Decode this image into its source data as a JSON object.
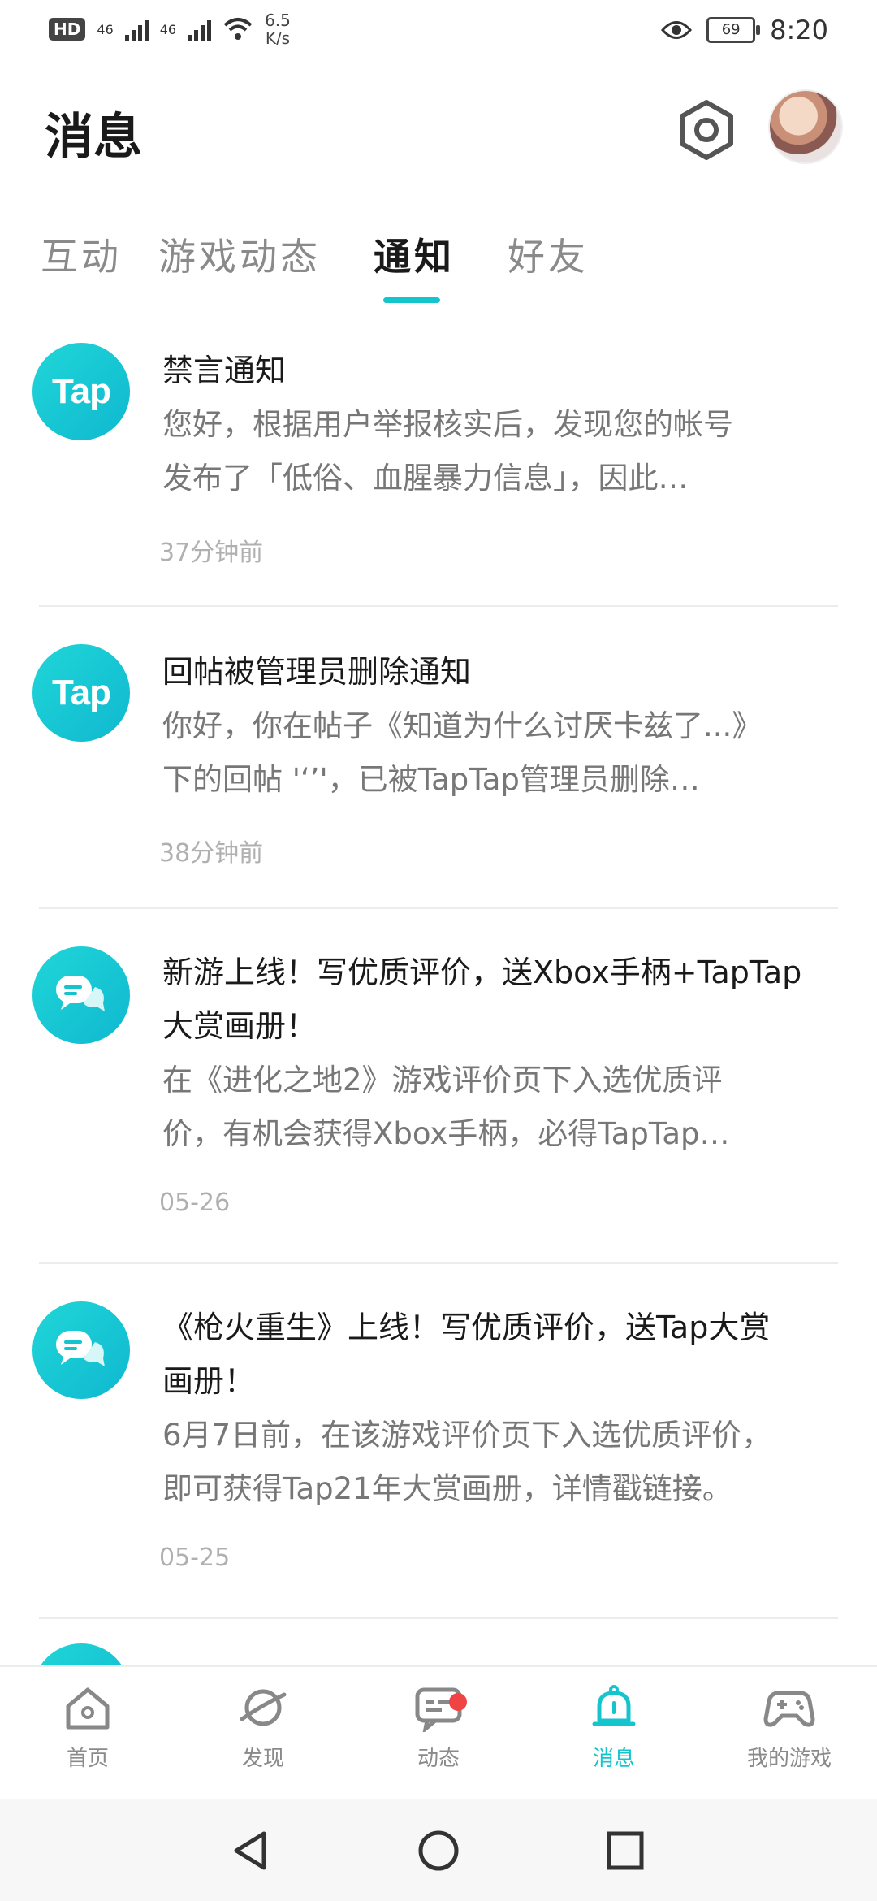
{
  "status_bar": {
    "hd": "HD",
    "sim1": "46",
    "sim2": "46",
    "speed_value": "6.5",
    "speed_unit": "K/s",
    "battery": "69",
    "time": "8:20"
  },
  "header": {
    "title": "消息"
  },
  "tabs": [
    {
      "label": "互动",
      "active": false
    },
    {
      "label": "游戏动态",
      "active": false
    },
    {
      "label": "通知",
      "active": true
    },
    {
      "label": "好友",
      "active": false
    }
  ],
  "notifications": [
    {
      "icon": "tap-logo",
      "icon_text": "Tap",
      "title": "禁言通知",
      "body1": "您好，根据用户举报核实后，发现您的帐号",
      "body2": "发布了「低俗、血腥暴力信息」，因此…",
      "time": "37分钟前"
    },
    {
      "icon": "tap-logo",
      "icon_text": "Tap",
      "title": "回帖被管理员删除通知",
      "body1": "你好，你在帖子《知道为什么讨厌卡兹了...》",
      "body2": "下的回帖 '‘’'，已被TapTap管理员删除…",
      "time": "38分钟前"
    },
    {
      "icon": "message-bubble-icon",
      "title1": "新游上线！写优质评价，送Xbox手柄+TapTap",
      "title2": "大赏画册！",
      "body1": "在《进化之地2》游戏评价页下入选优质评",
      "body2": "价，有机会获得Xbox手柄，必得TapTap…",
      "time": "05-26"
    },
    {
      "icon": "message-bubble-icon",
      "title1": "《枪火重生》上线！写优质评价，送Tap大赏",
      "title2": "画册！",
      "body1": "6月7日前，在该游戏评价页下入选优质评价，",
      "body2": "即可获得Tap21年大赏画册，详情戳链接。",
      "time": "05-25"
    }
  ],
  "bottom_nav": [
    {
      "label": "首页",
      "icon": "home-icon",
      "active": false
    },
    {
      "label": "发现",
      "icon": "planet-icon",
      "active": false
    },
    {
      "label": "动态",
      "icon": "chat-icon",
      "active": false,
      "badge": true
    },
    {
      "label": "消息",
      "icon": "bell-icon",
      "active": true
    },
    {
      "label": "我的游戏",
      "icon": "gamepad-icon",
      "active": false
    }
  ],
  "colors": {
    "accent": "#15c5ce",
    "badge": "#f04444"
  }
}
